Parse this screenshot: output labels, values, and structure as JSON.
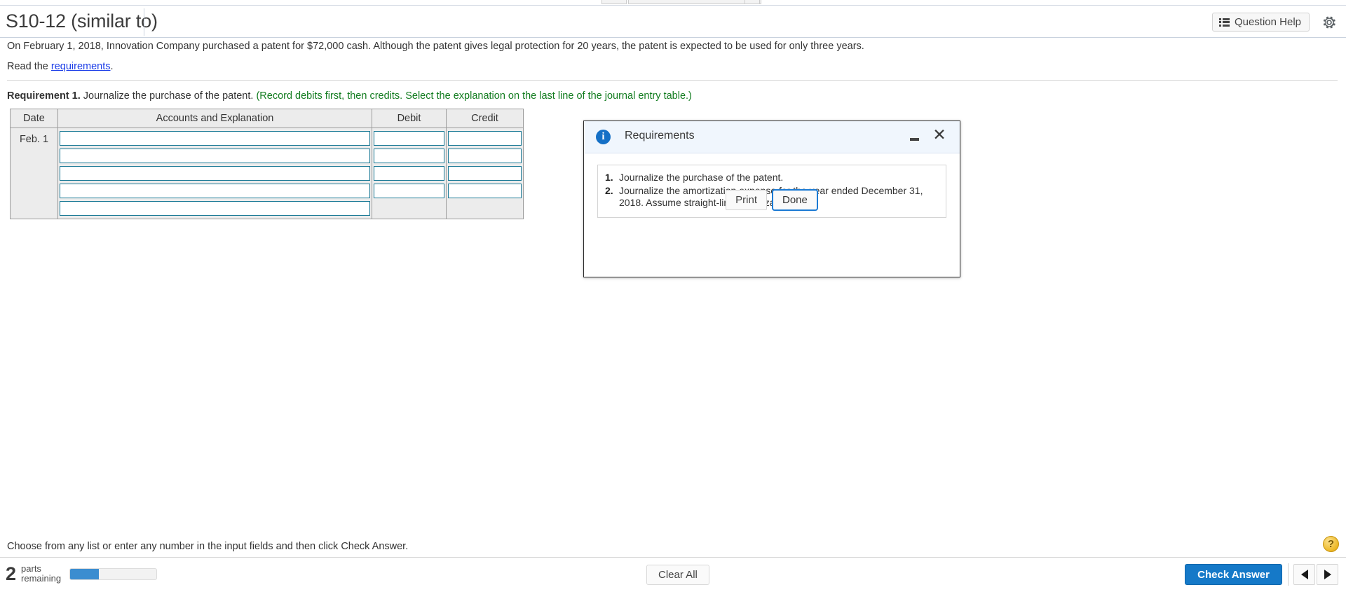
{
  "header": {
    "title": "S10-12 (similar to)",
    "question_help_label": "Question Help",
    "question_help_icon": "list-icon",
    "settings_icon": "gear-icon"
  },
  "problem": {
    "statement": "On February 1, 2018, Innovation Company purchased a patent for $72,000 cash. Although the patent gives legal protection for 20 years, the patent is expected to be used for only three years.",
    "read_prefix": "Read the ",
    "read_link": "requirements",
    "read_suffix": "."
  },
  "requirement": {
    "number": "Requirement 1.",
    "text": " Journalize the purchase of the patent. ",
    "hint": "(Record debits first, then credits. Select the explanation on the last line of the journal entry table.)"
  },
  "journal": {
    "columns": [
      "Date",
      "Accounts and Explanation",
      "Debit",
      "Credit"
    ],
    "date_value": "Feb. 1",
    "rows": 5,
    "account_values": [
      "",
      "",
      "",
      "",
      ""
    ],
    "debit_values": [
      "",
      "",
      "",
      ""
    ],
    "credit_values": [
      "",
      "",
      "",
      ""
    ]
  },
  "dialog": {
    "title": "Requirements",
    "info_icon": "info-icon",
    "minimize_icon": "minimize-icon",
    "close_icon": "close-icon",
    "items": [
      {
        "marker": "1.",
        "text": "Journalize the purchase of the patent."
      },
      {
        "marker": "2.",
        "text": "Journalize the amortization expense for the year ended December 31, 2018. Assume straight-line amortization."
      }
    ],
    "print_label": "Print",
    "done_label": "Done"
  },
  "footer": {
    "hint": "Choose from any list or enter any number in the input fields and then click Check Answer.",
    "help_icon_label": "?",
    "parts_count": "2",
    "parts_label_line1": "parts",
    "parts_label_line2": "remaining",
    "progress_percent": 33,
    "clear_all_label": "Clear All",
    "check_answer_label": "Check Answer",
    "prev_icon": "triangle-left-icon",
    "next_icon": "triangle-right-icon"
  },
  "colors": {
    "accent_blue": "#1579c8",
    "link_blue": "#1a3ce8",
    "hint_green": "#127c1f",
    "input_border": "#1b7a96",
    "table_bg": "#ececec",
    "help_gold": "#edb827"
  }
}
